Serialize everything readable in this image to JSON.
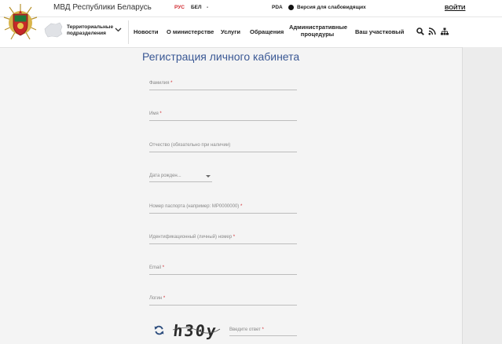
{
  "header": {
    "site_title": "МВД Республики Беларусь",
    "lang_ru": "РУС",
    "lang_by": "БЕЛ",
    "lang_more": "-",
    "pda": "PDA",
    "low_vision": "Версия для слабовидящих",
    "login": "ВОЙТИ"
  },
  "nav": {
    "region_line1": "Территориальные",
    "region_line2": "подразделения",
    "items": [
      "Новости",
      "О министерстве",
      "Услуги",
      "Обращения"
    ],
    "admin_line1": "Административные",
    "admin_line2": "процедуры",
    "officer": "Ваш участковый",
    "icons": [
      "search-icon",
      "rss-icon",
      "sitemap-icon"
    ]
  },
  "form": {
    "title": "Регистрация личного кабинета",
    "required_mark": "*",
    "fields": [
      {
        "label": "Фамилия",
        "required": true
      },
      {
        "label": "Имя",
        "required": true
      },
      {
        "label": "Отчество (обязательно при наличии)",
        "required": false
      },
      {
        "label": "Номер паспорта (например: MP0000000)",
        "required": true
      },
      {
        "label": "Идентификационный (личный) номер",
        "required": true
      },
      {
        "label": "Email",
        "required": true
      },
      {
        "label": "Логин",
        "required": true
      }
    ],
    "birth_date": "Дата рожден...",
    "captcha_text": "h30y",
    "answer_placeholder": "Введите ответ"
  },
  "colors": {
    "accent": "#d0282e",
    "title_blue": "#3a5894"
  }
}
